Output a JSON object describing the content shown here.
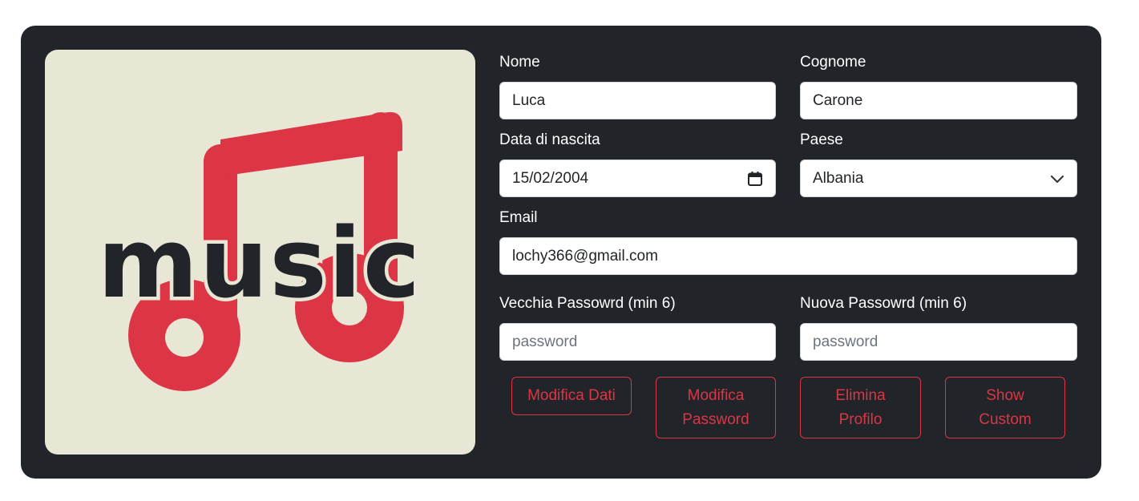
{
  "logo": {
    "wordmark": "music",
    "accent": "#dc3545"
  },
  "form": {
    "nome": {
      "label": "Nome",
      "value": "Luca"
    },
    "cognome": {
      "label": "Cognome",
      "value": "Carone"
    },
    "data_nascita": {
      "label": "Data di nascita",
      "value": "15/02/2004",
      "icon": "calendar-icon"
    },
    "paese": {
      "label": "Paese",
      "value": "Albania",
      "icon": "chevron-down-icon"
    },
    "email": {
      "label": "Email",
      "value": "lochy366@gmail.com"
    },
    "vecchia_password": {
      "label": "Vecchia Passowrd (min 6)",
      "placeholder": "password"
    },
    "nuova_password": {
      "label": "Nuova Passowrd (min 6)",
      "placeholder": "password"
    }
  },
  "buttons": {
    "modifica_dati": "Modifica Dati",
    "modifica_password": [
      "Modifica",
      "Password"
    ],
    "elimina_profilo": [
      "Elimina",
      "Profilo"
    ],
    "show_custom": [
      "Show",
      "Custom"
    ]
  },
  "colors": {
    "card": "#212529",
    "logo_bg": "#e8e6d4",
    "danger": "#dc3545"
  }
}
